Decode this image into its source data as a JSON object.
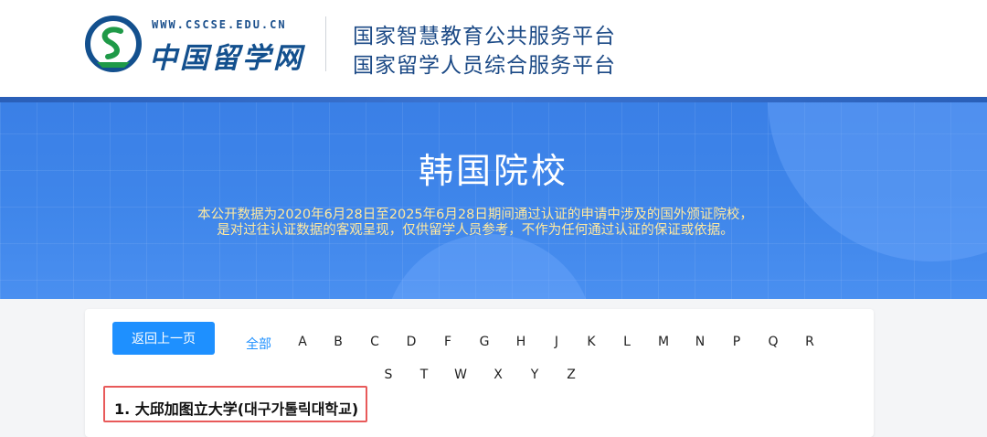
{
  "header": {
    "logo_url": "WWW.CSCSE.EDU.CN",
    "logo_name": "中国留学网",
    "platform_line1": "国家智慧教育公共服务平台",
    "platform_line2": "国家留学人员综合服务平台"
  },
  "banner": {
    "title": "韩国院校",
    "desc_line1": "本公开数据为2020年6月28日至2025年6月28日期间通过认证的申请中涉及的国外颁证院校，",
    "desc_line2": "是对过往认证数据的客观呈现，仅供留学人员参考，不作为任何通过认证的保证或依据。"
  },
  "nav": {
    "back_label": "返回上一页",
    "all_label": "全部",
    "letters_row1": [
      "A",
      "B",
      "C",
      "D",
      "F",
      "G",
      "H",
      "J",
      "K",
      "L",
      "M",
      "N",
      "P",
      "Q",
      "R"
    ],
    "letters_row2": [
      "S",
      "T",
      "W",
      "X",
      "Y",
      "Z"
    ]
  },
  "list": {
    "items": [
      {
        "text": "1.  大邱加图立大学(대구가톨릭대학교)"
      }
    ]
  },
  "colors": {
    "accent": "#1e90ff",
    "banner_blue": "#3f86ea",
    "banner_text": "#ffe9a0",
    "highlight_border": "#e85a5a"
  }
}
